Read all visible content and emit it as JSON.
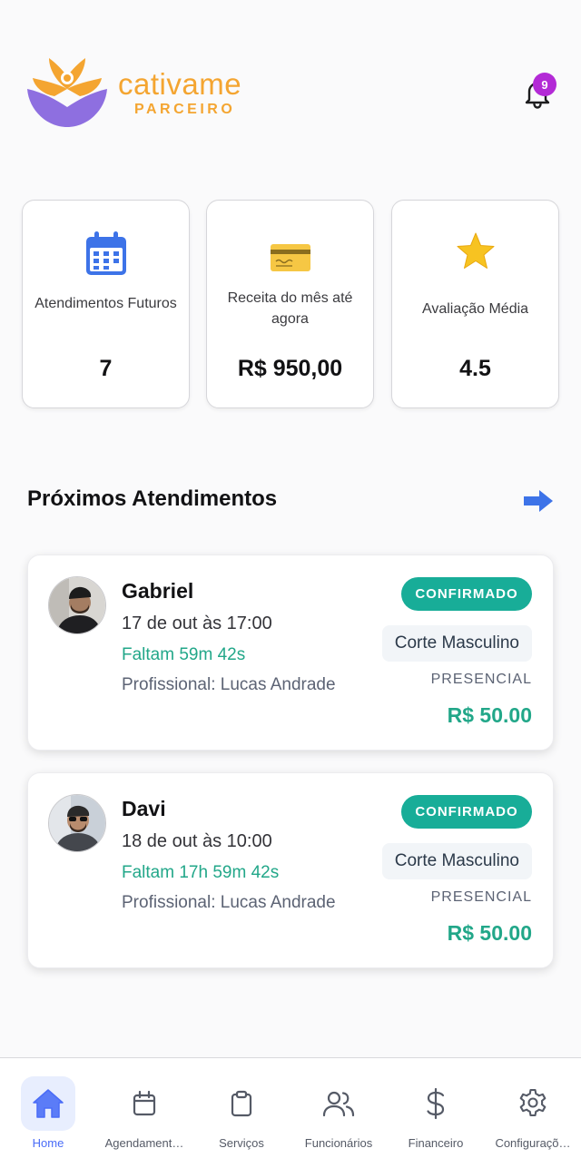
{
  "header": {
    "brand": "cativame",
    "brand_sub": "PARCEIRO",
    "notification_count": "9"
  },
  "stats": [
    {
      "label": "Atendimentos Futuros",
      "value": "7",
      "icon": "calendar-icon"
    },
    {
      "label": "Receita do mês até agora",
      "value": "R$ 950,00",
      "icon": "credit-card-icon"
    },
    {
      "label": "Avaliação Média",
      "value": "4.5",
      "icon": "star-icon"
    }
  ],
  "section": {
    "title": "Próximos Atendimentos"
  },
  "appointments": [
    {
      "client": "Gabriel",
      "date": "17 de out às 17:00",
      "countdown": "Faltam 59m 42s",
      "professional": "Profissional: Lucas Andrade",
      "status": "CONFIRMADO",
      "service": "Corte Masculino",
      "mode": "PRESENCIAL",
      "price": "R$ 50.00"
    },
    {
      "client": "Davi",
      "date": "18 de out às 10:00",
      "countdown": "Faltam 17h 59m 42s",
      "professional": "Profissional: Lucas Andrade",
      "status": "CONFIRMADO",
      "service": "Corte Masculino",
      "mode": "PRESENCIAL",
      "price": "R$ 50.00"
    }
  ],
  "nav": [
    {
      "label": "Home",
      "icon": "home-icon",
      "active": true
    },
    {
      "label": "Agendament…",
      "icon": "calendar-icon"
    },
    {
      "label": "Serviços",
      "icon": "clipboard-icon"
    },
    {
      "label": "Funcionários",
      "icon": "users-icon"
    },
    {
      "label": "Financeiro",
      "icon": "dollar-icon"
    },
    {
      "label": "Configuraçõ…",
      "icon": "gear-icon"
    }
  ],
  "colors": {
    "brand": "#f4a531",
    "logo_purple": "#8e6fe0",
    "accent_green": "#22a789",
    "status_teal": "#18ad98",
    "nav_active": "#4a6cf7"
  }
}
